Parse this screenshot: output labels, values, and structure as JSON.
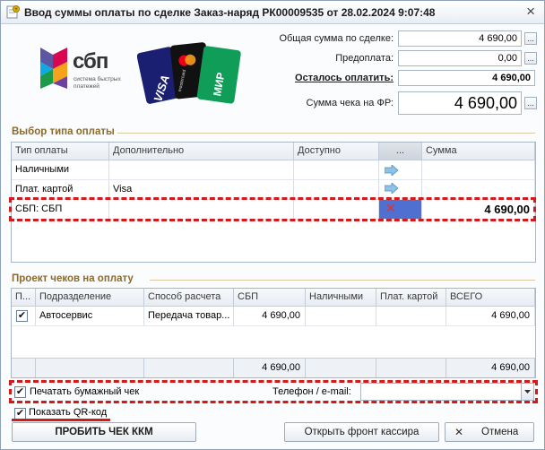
{
  "window": {
    "title": "Ввод суммы оплаты по сделке Заказ-наряд РК00009535 от 28.02.2024 9:07:48",
    "close_glyph": "×"
  },
  "logos": {
    "sbp_word": "сбп",
    "sbp_sub": [
      "система быстрых",
      "платежей"
    ],
    "card1": "VISA",
    "card2": "mastercard",
    "card3": "МИР"
  },
  "summary": {
    "total_label": "Общая сумма по сделке:",
    "total_value": "4 690,00",
    "prepay_label": "Предоплата:",
    "prepay_value": "0,00",
    "remaining_label": "Осталось оплатить:",
    "remaining_value": "4 690,00",
    "receipt_label": "Сумма чека на ФР:",
    "receipt_value": "4 690,00",
    "field_button": "..."
  },
  "payment_section": {
    "title": "Выбор типа оплаты",
    "columns": [
      "Тип оплаты",
      "Дополнительно",
      "Доступно",
      "...",
      "Сумма"
    ],
    "rows": [
      {
        "type": "Наличными",
        "extra": "",
        "available": "",
        "sum": ""
      },
      {
        "type": "Плат. картой",
        "extra": "Visa",
        "available": "",
        "sum": ""
      },
      {
        "type": "СБП: СБП",
        "extra": "",
        "available": "",
        "sum": "4 690,00"
      }
    ]
  },
  "checks_section": {
    "title": "Проект чеков на оплату",
    "columns": [
      "П...",
      "Подразделение",
      "Способ расчета",
      "СБП",
      "Наличными",
      "Плат. картой",
      "ВСЕГО"
    ],
    "rows": [
      {
        "checked": "✔",
        "division": "Автосервис",
        "method": "Передача товар...",
        "sbp": "4 690,00",
        "cash": "",
        "card": "",
        "total": "4 690,00"
      }
    ],
    "footer": {
      "sbp": "4 690,00",
      "total": "4 690,00"
    }
  },
  "options": {
    "print_paper_label": "Печатать бумажный чек",
    "print_paper_check": "✔",
    "phone_label": "Телефон / e-mail:",
    "phone_value": "",
    "show_qr_label": "Показать QR-код",
    "show_qr_check": "✔"
  },
  "buttons": {
    "punch": "ПРОБИТЬ ЧЕК ККМ",
    "open_front": "Открыть фронт кассира",
    "cancel": "Отмена"
  },
  "colors": {
    "section_title": "#8a6a2c",
    "highlight": "#d21a1a",
    "sbp_cell": "#4f6fd1"
  }
}
